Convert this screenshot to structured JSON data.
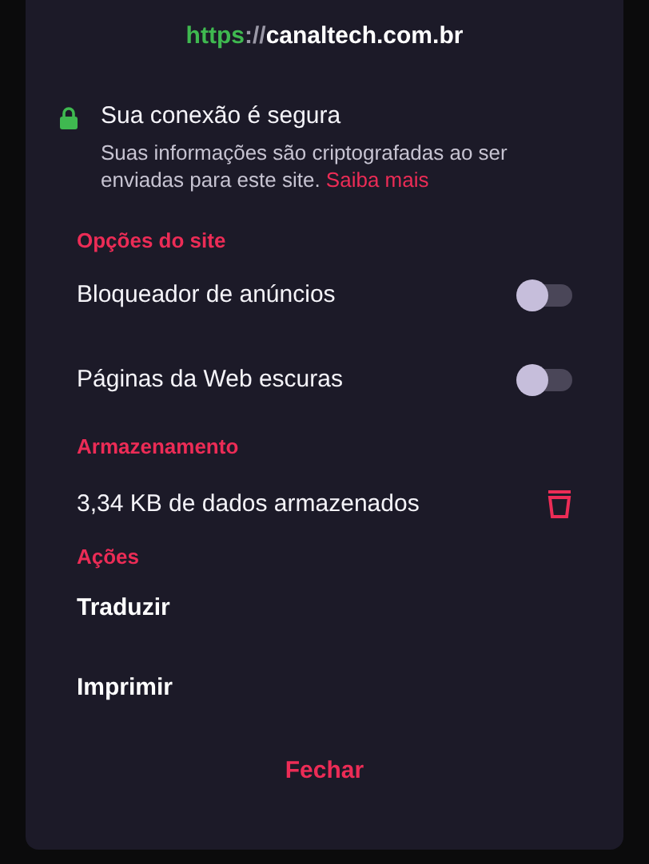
{
  "url": {
    "scheme": "https",
    "separator": "://",
    "host": "canaltech.com.br"
  },
  "connection": {
    "title": "Sua conexão é segura",
    "description": "Suas informações são criptografadas ao ser enviadas para este site.",
    "link": "Saiba mais"
  },
  "site_options": {
    "heading": "Opções do site",
    "items": [
      {
        "label": "Bloqueador de anúncios",
        "on": false
      },
      {
        "label": "Páginas da Web escuras",
        "on": false
      }
    ]
  },
  "storage": {
    "heading": "Armazenamento",
    "label": "3,34 KB de dados armazenados"
  },
  "actions": {
    "heading": "Ações",
    "items": [
      "Traduzir",
      "Imprimir"
    ]
  },
  "close_button": "Fechar"
}
